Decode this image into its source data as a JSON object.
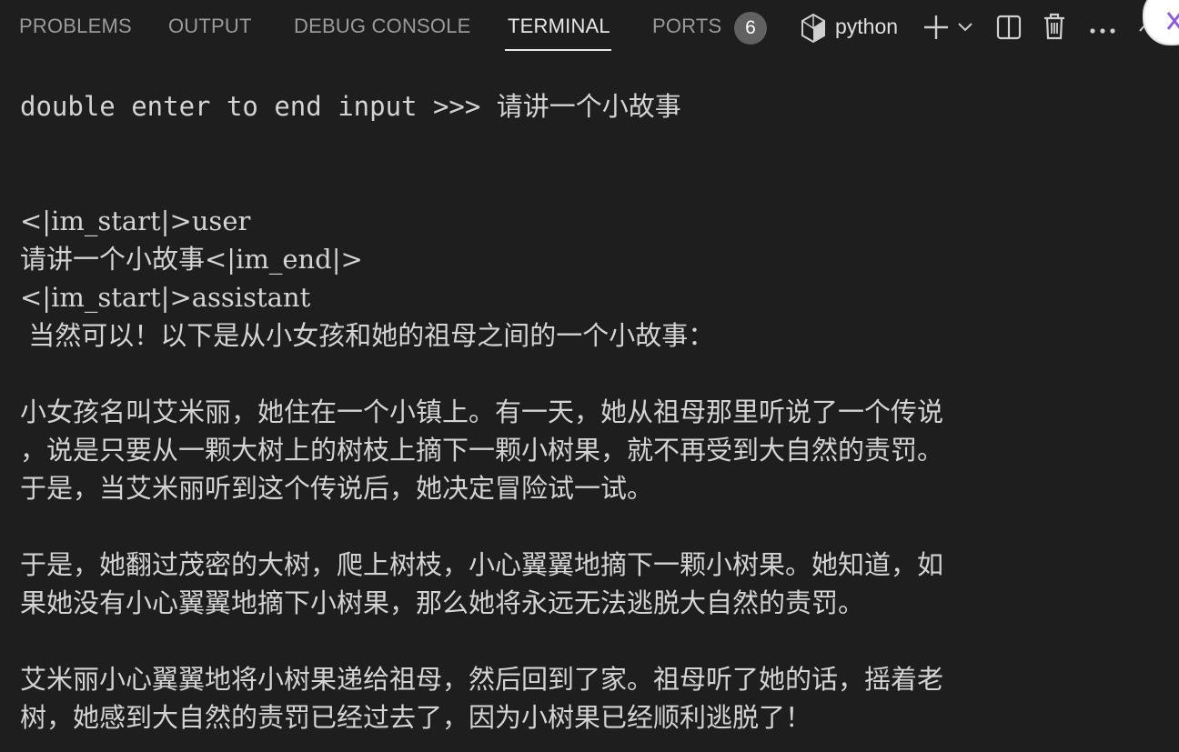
{
  "panel": {
    "tabs": [
      {
        "label": "PROBLEMS"
      },
      {
        "label": "OUTPUT"
      },
      {
        "label": "DEBUG CONSOLE"
      },
      {
        "label": "TERMINAL",
        "active": true
      },
      {
        "label": "PORTS"
      }
    ],
    "ports_count": "6",
    "shell_name": "python",
    "icons": [
      "python-file-icon",
      "plus-icon",
      "chevron-down-icon",
      "split-terminal-icon",
      "trash-icon",
      "more-icon",
      "maximize-chevron-icon"
    ]
  },
  "terminal": {
    "lines": [
      "double enter to end input >>> 请讲一个小故事",
      "<|im_start|>user",
      "请讲一个小故事<|im_end|>",
      "<|im_start|>assistant",
      " 当然可以！以下是从小女孩和她的祖母之间的一个小故事：",
      "小女孩名叫艾米丽，她住在一个小镇上。有一天，她从祖母那里听说了一个传说",
      "，说是只要从一颗大树上的树枝上摘下一颗小树果，就不再受到大自然的责罚。",
      "于是，当艾米丽听到这个传说后，她决定冒险试一试。",
      "于是，她翻过茂密的大树，爬上树枝，小心翼翼地摘下一颗小树果。她知道，如",
      "果她没有小心翼翼地摘下小树果，那么她将永远无法逃脱大自然的责罚。",
      "艾米丽小心翼翼地将小树果递给祖母，然后回到了家。祖母听了她的话，摇着老",
      "树，她感到大自然的责罚已经过去了，因为小树果已经顺利逃脱了！"
    ]
  },
  "colors": {
    "background": "#1e1e1e",
    "text": "#d4d4d4",
    "tab_inactive": "#9a9a9a",
    "tab_active": "#e7e7e7",
    "badge": "#616161"
  }
}
